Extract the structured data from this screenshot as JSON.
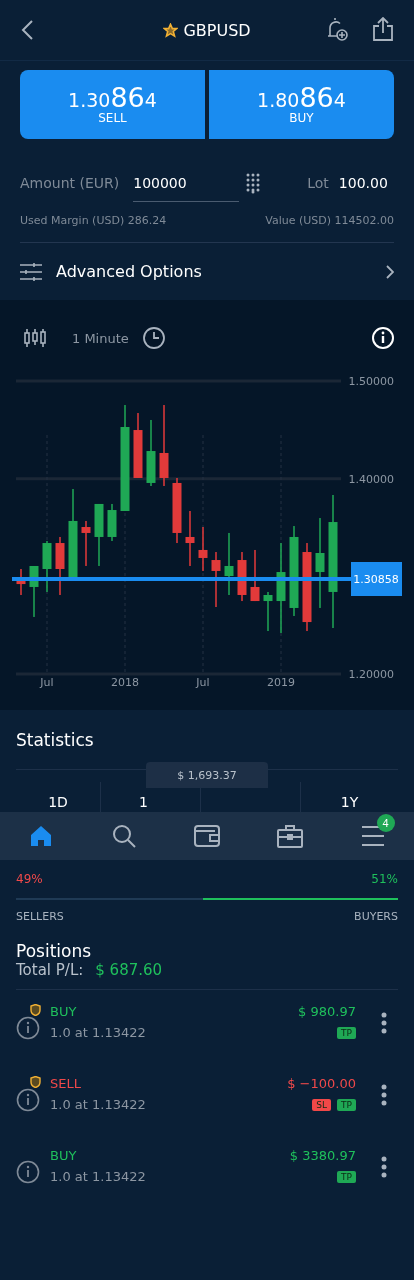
{
  "header": {
    "symbol": "GBPUSD",
    "favorite": true
  },
  "quote": [
    {
      "head": "1.30",
      "big": "86",
      "tail": "4",
      "label": "SELL"
    },
    {
      "head": "1.80",
      "big": "86",
      "tail": "4",
      "label": "BUY"
    }
  ],
  "order": {
    "amount_label": "Amount (EUR)",
    "amount_value": "100000",
    "lot_label": "Lot",
    "lot_value": "100.00",
    "used_margin": "Used Margin (USD) 286.24",
    "value": "Value (USD) 114502.00"
  },
  "advanced_options": "Advanced Options",
  "chart": {
    "interval": "1 Minute",
    "chart_data": {
      "type": "candlestick",
      "categories": [
        null,
        null,
        "Jul",
        null,
        null,
        null,
        null,
        null,
        "2018",
        null,
        null,
        null,
        null,
        null,
        "Jul",
        null,
        null,
        null,
        null,
        null,
        "2019",
        null,
        null,
        null,
        null
      ],
      "ohlc": [
        [
          1.2973,
          1.3075,
          1.2809,
          1.2921
        ],
        [
          1.2891,
          1.3106,
          1.2584,
          1.3106
        ],
        [
          1.3075,
          1.3362,
          1.284,
          1.3341
        ],
        [
          1.3341,
          1.3403,
          1.2809,
          1.3075
        ],
        [
          1.2983,
          1.3894,
          1.2983,
          1.3567
        ],
        [
          1.3505,
          1.3567,
          1.3106,
          1.3444
        ],
        [
          1.3403,
          1.3741,
          1.3106,
          1.3741
        ],
        [
          1.3403,
          1.3741,
          1.3362,
          1.3679
        ],
        [
          1.3669,
          1.4754,
          1.3669,
          1.4529
        ],
        [
          1.4498,
          1.4672,
          1.4007,
          1.4007
        ],
        [
          1.3956,
          1.4601,
          1.3925,
          1.4283
        ],
        [
          1.4263,
          1.4754,
          1.3925,
          1.4007
        ],
        [
          1.3956,
          1.4007,
          1.3341,
          1.3444
        ],
        [
          1.3403,
          1.3669,
          1.3106,
          1.3341
        ],
        [
          1.327,
          1.3505,
          1.3055,
          1.3188
        ],
        [
          1.3167,
          1.3249,
          1.2686,
          1.3055
        ],
        [
          1.3003,
          1.3444,
          1.2809,
          1.3106
        ],
        [
          1.3167,
          1.3249,
          1.2747,
          1.2809
        ],
        [
          1.2891,
          1.327,
          1.2747,
          1.2747
        ],
        [
          1.2747,
          1.284,
          1.244,
          1.2809
        ],
        [
          1.2747,
          1.3341,
          1.242,
          1.3044
        ],
        [
          1.2676,
          1.3515,
          1.2594,
          1.3403
        ],
        [
          1.3249,
          1.3341,
          1.244,
          1.2532
        ],
        [
          1.3044,
          1.3597,
          1.2676,
          1.3239
        ],
        [
          1.284,
          1.3833,
          1.2471,
          1.3556
        ]
      ],
      "ylim": [
        1.2,
        1.5
      ],
      "yticks": [
        {
          "value": 1.5,
          "label": "1.50000"
        },
        {
          "value": 1.4,
          "label": "1.40000"
        },
        {
          "value": 1.2,
          "label": "1.20000"
        }
      ],
      "grid": true
    },
    "current_price": "1.30858"
  },
  "statistics": {
    "title": "Statistics",
    "periods": [
      "1D",
      "1",
      "1Y"
    ]
  },
  "balance": "$ 1,693.37",
  "nav": [
    {
      "kind": "home",
      "selected": true
    },
    {
      "kind": "search",
      "selected": false
    },
    {
      "kind": "wallet",
      "selected": false
    },
    {
      "kind": "briefcase",
      "selected": false
    },
    {
      "kind": "menu",
      "selected": false,
      "badge": "4"
    }
  ],
  "sentiment": {
    "sellers_pct": "49%",
    "buyers_pct": "51%",
    "level": 0.51,
    "sellers_label": "SELLERS",
    "buyers_label": "BUYERS"
  },
  "positions": {
    "title": "Positions",
    "total_label": "Total P/L:",
    "total_value": "$ 687.60",
    "items": [
      {
        "kind": "buy",
        "side": "BUY",
        "protected": true,
        "detail": "1.0 at 1.13422",
        "pl": "$ 980.97",
        "tags": [
          {
            "kind": "tp",
            "label": "TP"
          }
        ]
      },
      {
        "kind": "sell",
        "side": "SELL",
        "protected": true,
        "detail": "1.0 at 1.13422",
        "pl": "$ −100.00",
        "tags": [
          {
            "kind": "sl",
            "label": "SL"
          },
          {
            "kind": "tp",
            "label": "TP"
          }
        ]
      },
      {
        "kind": "buy",
        "side": "BUY",
        "protected": false,
        "detail": "1.0 at 1.13422",
        "pl": "$ 3380.97",
        "tags": [
          {
            "kind": "tp",
            "label": "TP"
          }
        ]
      }
    ]
  }
}
